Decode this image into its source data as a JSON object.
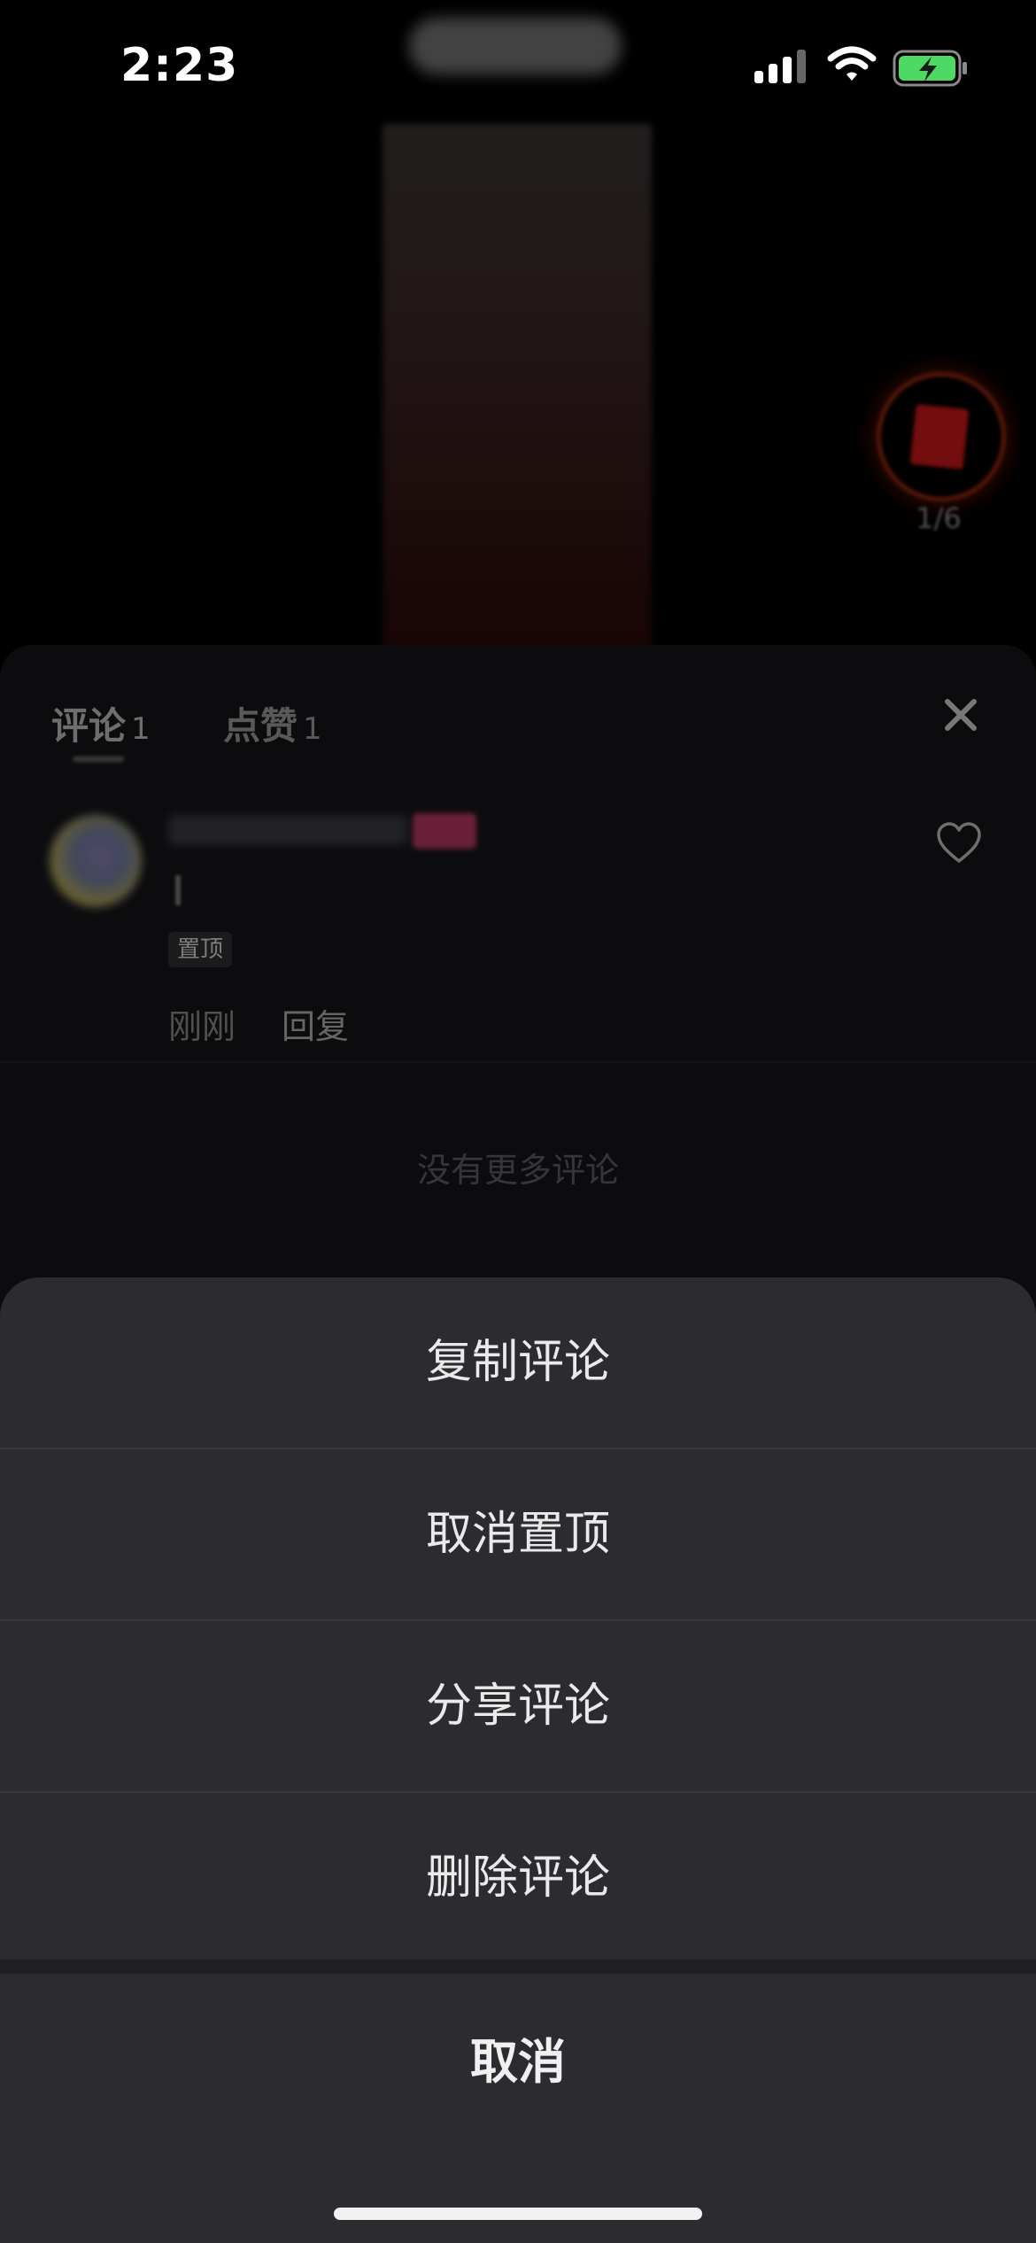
{
  "status_bar": {
    "time": "2:23"
  },
  "media": {
    "page_indicator": "1/6"
  },
  "comments_panel": {
    "tabs": [
      {
        "label": "评论",
        "count": "1"
      },
      {
        "label": "点赞",
        "count": "1"
      }
    ],
    "comment": {
      "pinned_tag": "置顶",
      "time": "刚刚",
      "reply_label": "回复"
    },
    "empty_state": "没有更多评论"
  },
  "action_sheet": {
    "items": [
      {
        "label": "复制评论"
      },
      {
        "label": "取消置顶"
      },
      {
        "label": "分享评论"
      },
      {
        "label": "删除评论"
      }
    ],
    "cancel_label": "取消"
  },
  "colors": {
    "sheet_bg": "#2b2b30",
    "panel_bg": "#16161b",
    "battery_green": "#4cd964"
  }
}
